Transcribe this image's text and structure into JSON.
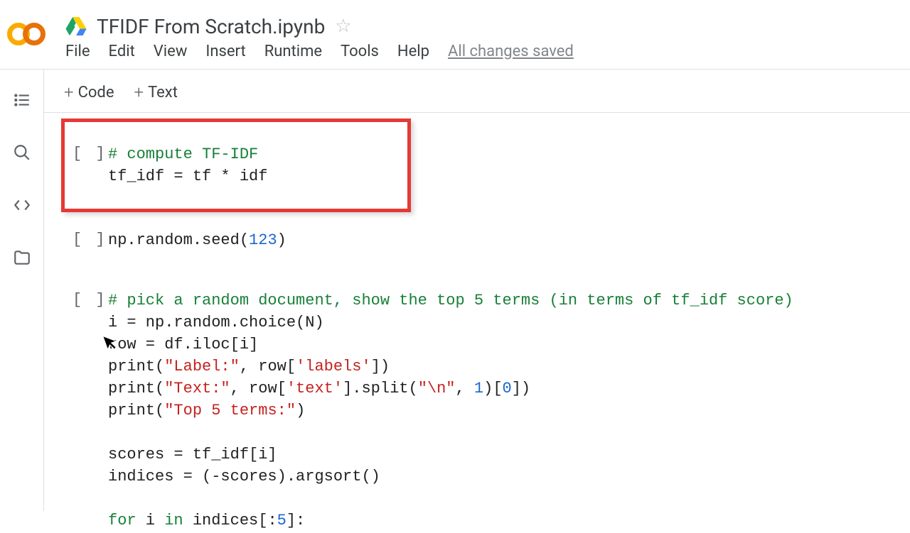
{
  "header": {
    "title": "TFIDF From Scratch.ipynb",
    "menu": {
      "file": "File",
      "edit": "Edit",
      "view": "View",
      "insert": "Insert",
      "runtime": "Runtime",
      "tools": "Tools",
      "help": "Help"
    },
    "save_status": "All changes saved"
  },
  "toolbar": {
    "code": "Code",
    "text": "Text"
  },
  "cells": [
    {
      "bracket": "[ ]",
      "lines": [
        {
          "type": "comment",
          "text": "# compute TF-IDF"
        },
        {
          "type": "plain",
          "text": "tf_idf = tf * idf"
        }
      ]
    },
    {
      "bracket": "[ ]",
      "lines": [
        {
          "type": "mixed",
          "text_prefix": "np.random.seed(",
          "num": "123",
          "text_suffix": ")"
        }
      ]
    },
    {
      "bracket": "[ ]",
      "lines": [
        {
          "type": "comment",
          "text": "# pick a random document, show the top 5 terms (in terms of tf_idf score)"
        },
        {
          "type": "plain",
          "text": "i = np.random.choice(N)"
        },
        {
          "type": "plain",
          "text": "row = df.iloc[i]"
        },
        {
          "type": "print2",
          "a": "print(",
          "s1": "\"Label:\"",
          "b": ", row[",
          "s2": "'labels'",
          "c": "])"
        },
        {
          "type": "print3",
          "a": "print(",
          "s1": "\"Text:\"",
          "b": ", row[",
          "s2": "'text'",
          "c": "].split(",
          "s3": "\"\\n\"",
          "d": ", ",
          "n": "1",
          "e": ")[",
          "n2": "0",
          "f": "])"
        },
        {
          "type": "print1",
          "a": "print(",
          "s1": "\"Top 5 terms:\"",
          "b": ")"
        },
        {
          "type": "blank",
          "text": ""
        },
        {
          "type": "plain",
          "text": "scores = tf_idf[i]"
        },
        {
          "type": "plain",
          "text": "indices = (-scores).argsort()"
        },
        {
          "type": "blank",
          "text": ""
        },
        {
          "type": "forloop",
          "kw": "for",
          "mid": " i ",
          "kw2": "in",
          "rest": " indices[:",
          "n": "5",
          "end": "]:"
        }
      ]
    }
  ]
}
